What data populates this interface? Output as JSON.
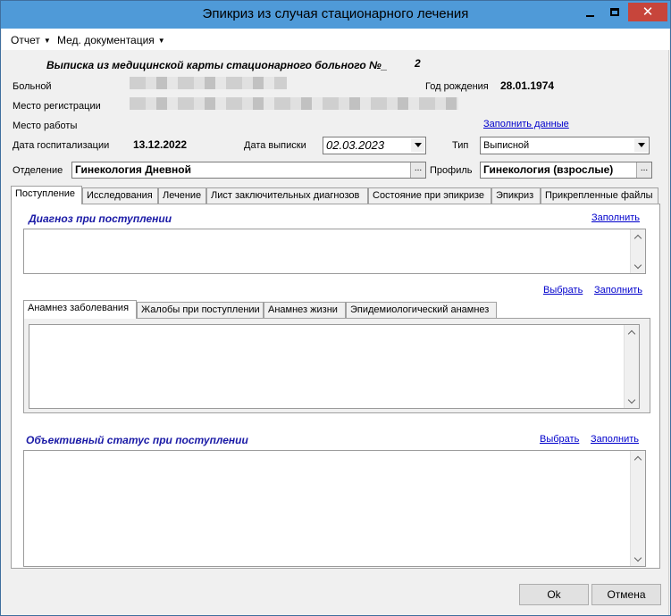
{
  "window": {
    "title": "Эпикриз из случая стационарного лечения"
  },
  "menu": [
    {
      "label": "Отчет"
    },
    {
      "label": "Мед. документация"
    }
  ],
  "header": {
    "heading": "Выписка из медицинской карты стационарного больного №_",
    "number": "2"
  },
  "patient": {
    "patient_label": "Больной",
    "birth_label": "Год рождения",
    "birth_value": "28.01.1974",
    "reg_label": "Место регистрации",
    "work_label": "Место работы",
    "fill_data_link": "Заполнить данные",
    "hosp_label": "Дата госпитализации",
    "hosp_value": "13.12.2022",
    "discharge_label": "Дата выписки",
    "discharge_value": "02.03.2023",
    "type_label": "Тип",
    "type_value": "Выписной",
    "dept_label": "Отделение",
    "dept_value": "Гинекология Дневной",
    "profile_label": "Профиль",
    "profile_value": "Гинекология (взрослые)",
    "ellipsis": "..."
  },
  "main_tabs": [
    {
      "label": "Поступление"
    },
    {
      "label": "Исследования"
    },
    {
      "label": "Лечение"
    },
    {
      "label": "Лист заключительных диагнозов"
    },
    {
      "label": "Состояние при эпикризе"
    },
    {
      "label": "Эпикриз"
    },
    {
      "label": "Прикрепленные файлы"
    }
  ],
  "admission": {
    "diagnosis_title": "Диагноз при поступлении",
    "fill_link": "Заполнить",
    "select_link": "Выбрать",
    "fill_link2": "Заполнить",
    "sub_tabs": [
      {
        "label": "Анамнез заболевания"
      },
      {
        "label": "Жалобы при поступлении"
      },
      {
        "label": "Анамнез жизни"
      },
      {
        "label": "Эпидемиологический анамнез"
      }
    ],
    "objective_title": "Объективный статус при поступлении",
    "select_link3": "Выбрать",
    "fill_link3": "Заполнить"
  },
  "buttons": {
    "ok": "Ok",
    "cancel": "Отмена"
  }
}
